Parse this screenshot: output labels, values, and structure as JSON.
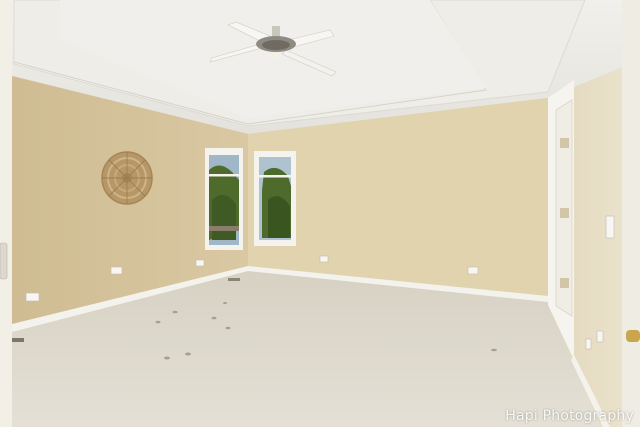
{
  "watermark": {
    "text": "Hapi Photography"
  },
  "colors": {
    "ceiling": "#ebeae5",
    "wall_left": "#d6c49d",
    "wall_back": "#e0d3ad",
    "wall_right": "#e6dcc2",
    "carpet": "#ddd8cc",
    "trim": "#f4f2ec",
    "foliage": "#4f6b2c"
  },
  "icons": [
    "ceiling-fan-icon",
    "rattan-wall-decor-icon",
    "window-icon",
    "door-icon",
    "outlet-icon",
    "light-switch-icon"
  ]
}
